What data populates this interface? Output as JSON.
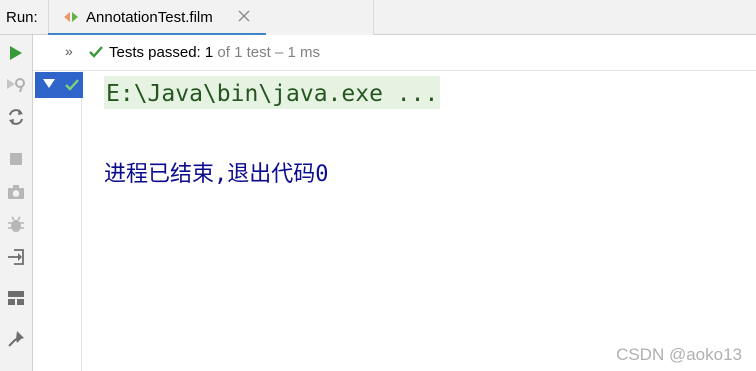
{
  "run_panel": {
    "label": "Run:",
    "tab": {
      "title": "AnnotationTest.film",
      "icon": "run-config-icon",
      "close_icon": "close-icon"
    }
  },
  "toolbar": {
    "items": [
      {
        "name": "rerun-icon",
        "color": "#3a9a3a"
      },
      {
        "name": "rerun-failed-icon",
        "color": "#b0b0b0"
      },
      {
        "name": "toggle-auto-test-icon",
        "color": "#6e6e6e"
      },
      {
        "name": "stop-icon",
        "color": "#b0b0b0"
      },
      {
        "name": "camera-icon",
        "color": "#b0b0b0"
      },
      {
        "name": "debug-icon",
        "color": "#b0b0b0"
      },
      {
        "name": "exit-icon",
        "color": "#6e6e6e"
      },
      {
        "name": "layout-icon",
        "color": "#6e6e6e"
      },
      {
        "name": "pin-icon",
        "color": "#6e6e6e"
      }
    ]
  },
  "status": {
    "expand_icon": "chevron-double-right-icon",
    "prefix": "Tests passed: ",
    "passed_count": "1",
    "suffix": " of 1 test – 1 ms",
    "success_color": "#3a9a3a"
  },
  "tree": {
    "selected_color": "#2f65ca",
    "expand_icon": "triangle-down-icon",
    "status_icon": "check-icon"
  },
  "console": {
    "command": "E:\\Java\\bin\\java.exe ...",
    "exit_message": "进程已结束,退出代码",
    "exit_code": "0"
  },
  "watermark": "CSDN @aoko13"
}
